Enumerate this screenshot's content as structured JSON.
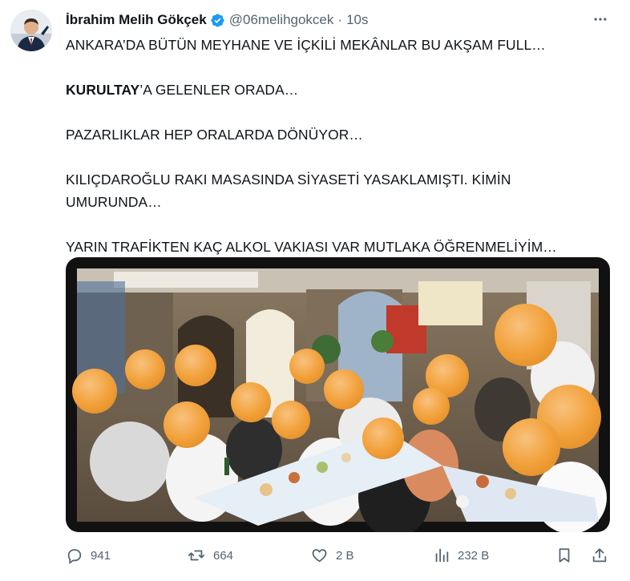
{
  "author": {
    "name": "İbrahim Melih Gökçek",
    "handle": "@06melihgokcek",
    "separator": "·",
    "time": "10s"
  },
  "tweet": {
    "line1": "ANKARA’DA BÜTÜN MEYHANE VE İÇKİLİ MEKÂNLAR BU AKŞAM FULL…",
    "line2_bold": "KURULTAY",
    "line2_rest": "’A GELENLER ORADA…",
    "line3": "PAZARLIKLAR HEP ORALARDA DÖNÜYOR…",
    "line4a": "KILIÇDAROĞLU RAKI MASASINDA SİYASETİ YASAKLAMIŞTI. KİMİN",
    "line4b": "UMURUNDA…",
    "line5": "YARIN TRAFİKTEN KAÇ ALKOL VAKIASI VAR MUTLAKA ÖĞRENMELİYİM…"
  },
  "media": {
    "alt": "Restaurant photo with faces blurred by orange circles",
    "colors": {
      "blur": "#f2a13a",
      "blur_light": "#f7c27a",
      "tablecloth": "#e9f0f7"
    }
  },
  "actions": {
    "reply": "941",
    "retweet": "664",
    "like": "2 B",
    "views": "232 B"
  },
  "colors": {
    "text": "#0f1419",
    "secondary": "#536471",
    "verified": "#1d9bf0"
  },
  "icons": [
    "more-icon",
    "verified-icon",
    "reply-icon",
    "retweet-icon",
    "like-icon",
    "views-icon",
    "bookmark-icon",
    "share-icon"
  ]
}
